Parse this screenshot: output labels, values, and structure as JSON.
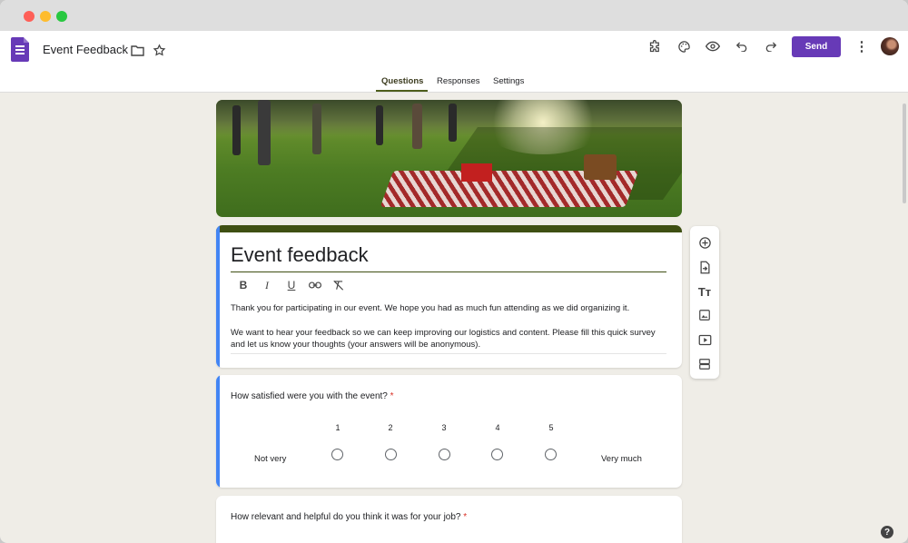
{
  "app": {
    "doc_title": "Event Feedback",
    "send_label": "Send",
    "accent_color": "#673ab7",
    "theme_color": "#3e4f12"
  },
  "toolbar_icons": [
    "folder-icon",
    "star-icon",
    "addon-puzzle-icon",
    "palette-icon",
    "preview-eye-icon",
    "undo-icon",
    "redo-icon",
    "more-vert-icon"
  ],
  "tabs": [
    {
      "label": "Questions",
      "active": true
    },
    {
      "label": "Responses",
      "active": false
    },
    {
      "label": "Settings",
      "active": false
    }
  ],
  "form": {
    "title": "Event feedback",
    "format_tools": [
      "B",
      "I",
      "U",
      "link",
      "clear-format"
    ],
    "description_p1": "Thank you for participating in our event. We hope you had as much fun attending as we did organizing it.",
    "description_p2": "We want to hear your feedback so we can keep improving our logistics and content. Please fill this quick survey and let us know your thoughts (your answers will be anonymous)."
  },
  "side_tools": [
    "add-question-icon",
    "import-questions-icon",
    "add-title-icon",
    "add-image-icon",
    "add-video-icon",
    "add-section-icon"
  ],
  "questions": [
    {
      "text": "How satisfied were you with the event?",
      "required_mark": "*",
      "scale": [
        "1",
        "2",
        "3",
        "4",
        "5"
      ],
      "low_label": "Not very",
      "high_label": "Very much"
    },
    {
      "text": "How relevant and helpful do you think it was for your job?",
      "required_mark": "*"
    }
  ],
  "help_label": "?"
}
